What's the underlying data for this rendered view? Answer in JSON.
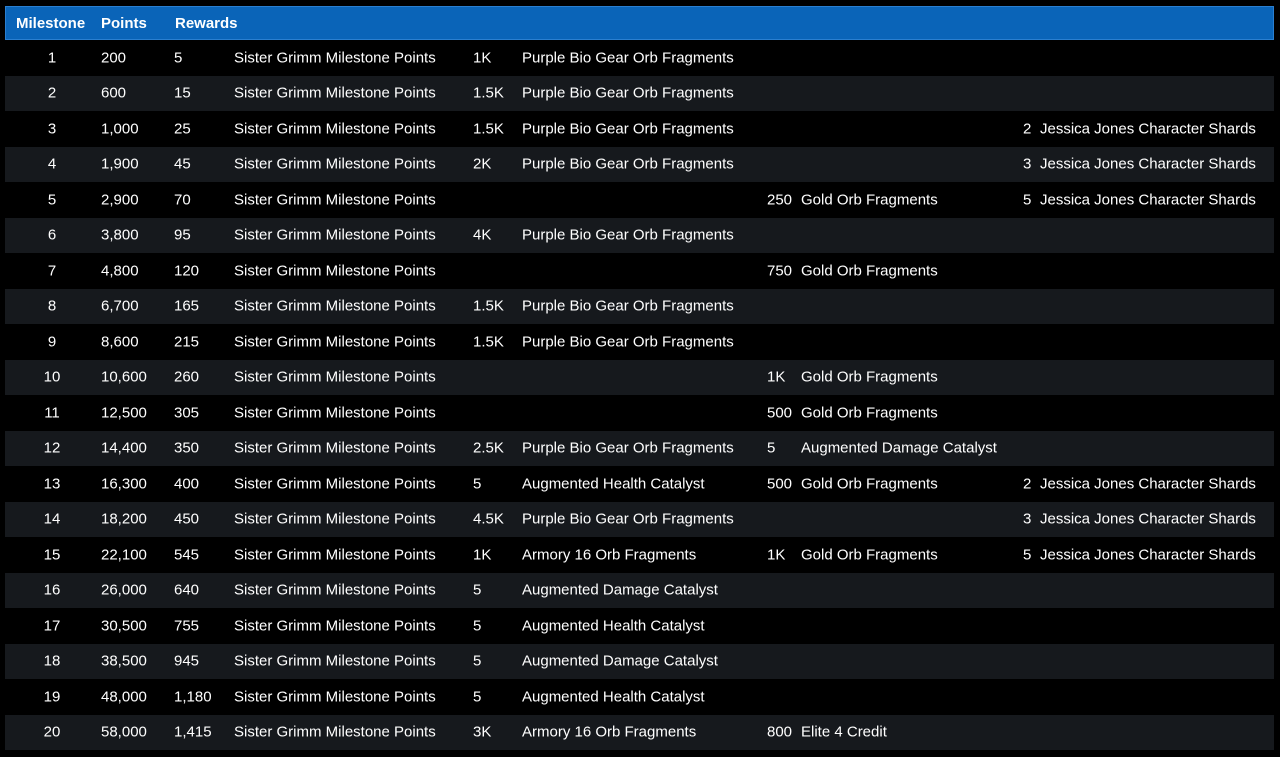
{
  "header": {
    "milestone": "Milestone",
    "points": "Points",
    "rewards": "Rewards"
  },
  "rows": [
    {
      "milestone": "1",
      "points": "200",
      "q1": "5",
      "n1": "Sister Grimm Milestone Points",
      "q2": "1K",
      "n2": "Purple Bio Gear Orb Fragments",
      "q3": "",
      "n3": "",
      "q4": "",
      "n4": ""
    },
    {
      "milestone": "2",
      "points": "600",
      "q1": "15",
      "n1": "Sister Grimm Milestone Points",
      "q2": "1.5K",
      "n2": "Purple Bio Gear Orb Fragments",
      "q3": "",
      "n3": "",
      "q4": "",
      "n4": ""
    },
    {
      "milestone": "3",
      "points": "1,000",
      "q1": "25",
      "n1": "Sister Grimm Milestone Points",
      "q2": "1.5K",
      "n2": "Purple Bio Gear Orb Fragments",
      "q3": "",
      "n3": "",
      "q4": "2",
      "n4": "Jessica Jones Character Shards"
    },
    {
      "milestone": "4",
      "points": "1,900",
      "q1": "45",
      "n1": "Sister Grimm Milestone Points",
      "q2": "2K",
      "n2": "Purple Bio Gear Orb Fragments",
      "q3": "",
      "n3": "",
      "q4": "3",
      "n4": "Jessica Jones Character Shards"
    },
    {
      "milestone": "5",
      "points": "2,900",
      "q1": "70",
      "n1": "Sister Grimm Milestone Points",
      "q2": "",
      "n2": "",
      "q3": "250",
      "n3": "Gold Orb Fragments",
      "q4": "5",
      "n4": "Jessica Jones Character Shards"
    },
    {
      "milestone": "6",
      "points": "3,800",
      "q1": "95",
      "n1": "Sister Grimm Milestone Points",
      "q2": "4K",
      "n2": "Purple Bio Gear Orb Fragments",
      "q3": "",
      "n3": "",
      "q4": "",
      "n4": ""
    },
    {
      "milestone": "7",
      "points": "4,800",
      "q1": "120",
      "n1": "Sister Grimm Milestone Points",
      "q2": "",
      "n2": "",
      "q3": "750",
      "n3": "Gold Orb Fragments",
      "q4": "",
      "n4": ""
    },
    {
      "milestone": "8",
      "points": "6,700",
      "q1": "165",
      "n1": "Sister Grimm Milestone Points",
      "q2": "1.5K",
      "n2": "Purple Bio Gear Orb Fragments",
      "q3": "",
      "n3": "",
      "q4": "",
      "n4": ""
    },
    {
      "milestone": "9",
      "points": "8,600",
      "q1": "215",
      "n1": "Sister Grimm Milestone Points",
      "q2": "1.5K",
      "n2": "Purple Bio Gear Orb Fragments",
      "q3": "",
      "n3": "",
      "q4": "",
      "n4": ""
    },
    {
      "milestone": "10",
      "points": "10,600",
      "q1": "260",
      "n1": "Sister Grimm Milestone Points",
      "q2": "",
      "n2": "",
      "q3": "1K",
      "n3": "Gold Orb Fragments",
      "q4": "",
      "n4": ""
    },
    {
      "milestone": "11",
      "points": "12,500",
      "q1": "305",
      "n1": "Sister Grimm Milestone Points",
      "q2": "",
      "n2": "",
      "q3": "500",
      "n3": "Gold Orb Fragments",
      "q4": "",
      "n4": ""
    },
    {
      "milestone": "12",
      "points": "14,400",
      "q1": "350",
      "n1": "Sister Grimm Milestone Points",
      "q2": "2.5K",
      "n2": "Purple Bio Gear Orb Fragments",
      "q3": "5",
      "n3": "Augmented Damage Catalyst",
      "q4": "",
      "n4": ""
    },
    {
      "milestone": "13",
      "points": "16,300",
      "q1": "400",
      "n1": "Sister Grimm Milestone Points",
      "q2": "5",
      "n2": "Augmented Health Catalyst",
      "q3": "500",
      "n3": "Gold Orb Fragments",
      "q4": "2",
      "n4": "Jessica Jones Character Shards"
    },
    {
      "milestone": "14",
      "points": "18,200",
      "q1": "450",
      "n1": "Sister Grimm Milestone Points",
      "q2": "4.5K",
      "n2": "Purple Bio Gear Orb Fragments",
      "q3": "",
      "n3": "",
      "q4": "3",
      "n4": "Jessica Jones Character Shards"
    },
    {
      "milestone": "15",
      "points": "22,100",
      "q1": "545",
      "n1": "Sister Grimm Milestone Points",
      "q2": "1K",
      "n2": "Armory 16 Orb Fragments",
      "q3": "1K",
      "n3": "Gold Orb Fragments",
      "q4": "5",
      "n4": "Jessica Jones Character Shards"
    },
    {
      "milestone": "16",
      "points": "26,000",
      "q1": "640",
      "n1": "Sister Grimm Milestone Points",
      "q2": "5",
      "n2": "Augmented Damage Catalyst",
      "q3": "",
      "n3": "",
      "q4": "",
      "n4": ""
    },
    {
      "milestone": "17",
      "points": "30,500",
      "q1": "755",
      "n1": "Sister Grimm Milestone Points",
      "q2": "5",
      "n2": "Augmented Health Catalyst",
      "q3": "",
      "n3": "",
      "q4": "",
      "n4": ""
    },
    {
      "milestone": "18",
      "points": "38,500",
      "q1": "945",
      "n1": "Sister Grimm Milestone Points",
      "q2": "5",
      "n2": "Augmented Damage Catalyst",
      "q3": "",
      "n3": "",
      "q4": "",
      "n4": ""
    },
    {
      "milestone": "19",
      "points": "48,000",
      "q1": "1,180",
      "n1": "Sister Grimm Milestone Points",
      "q2": "5",
      "n2": "Augmented Health Catalyst",
      "q3": "",
      "n3": "",
      "q4": "",
      "n4": ""
    },
    {
      "milestone": "20",
      "points": "58,000",
      "q1": "1,415",
      "n1": "Sister Grimm Milestone Points",
      "q2": "3K",
      "n2": "Armory 16 Orb Fragments",
      "q3": "800",
      "n3": "Elite 4 Credit",
      "q4": "",
      "n4": ""
    }
  ]
}
